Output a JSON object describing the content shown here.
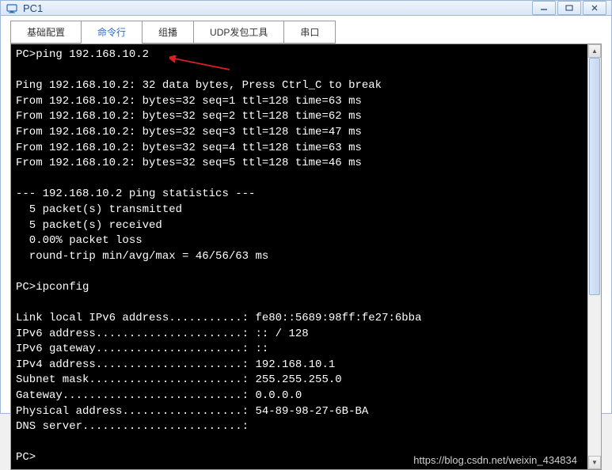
{
  "window": {
    "title": "PC1"
  },
  "tabs": {
    "items": [
      {
        "label": "基础配置"
      },
      {
        "label": "命令行"
      },
      {
        "label": "组播"
      },
      {
        "label": "UDP发包工具"
      },
      {
        "label": "串口"
      }
    ],
    "active_index": 1
  },
  "terminal": {
    "lines": [
      "PC>ping 192.168.10.2",
      "",
      "Ping 192.168.10.2: 32 data bytes, Press Ctrl_C to break",
      "From 192.168.10.2: bytes=32 seq=1 ttl=128 time=63 ms",
      "From 192.168.10.2: bytes=32 seq=2 ttl=128 time=62 ms",
      "From 192.168.10.2: bytes=32 seq=3 ttl=128 time=47 ms",
      "From 192.168.10.2: bytes=32 seq=4 ttl=128 time=63 ms",
      "From 192.168.10.2: bytes=32 seq=5 ttl=128 time=46 ms",
      "",
      "--- 192.168.10.2 ping statistics ---",
      "  5 packet(s) transmitted",
      "  5 packet(s) received",
      "  0.00% packet loss",
      "  round-trip min/avg/max = 46/56/63 ms",
      "",
      "PC>ipconfig",
      "",
      "Link local IPv6 address...........: fe80::5689:98ff:fe27:6bba",
      "IPv6 address......................: :: / 128",
      "IPv6 gateway......................: ::",
      "IPv4 address......................: 192.168.10.1",
      "Subnet mask.......................: 255.255.255.0",
      "Gateway...........................: 0.0.0.0",
      "Physical address..................: 54-89-98-27-6B-BA",
      "DNS server........................:",
      "",
      "PC>"
    ]
  },
  "watermark": "https://blog.csdn.net/weixin_434834"
}
